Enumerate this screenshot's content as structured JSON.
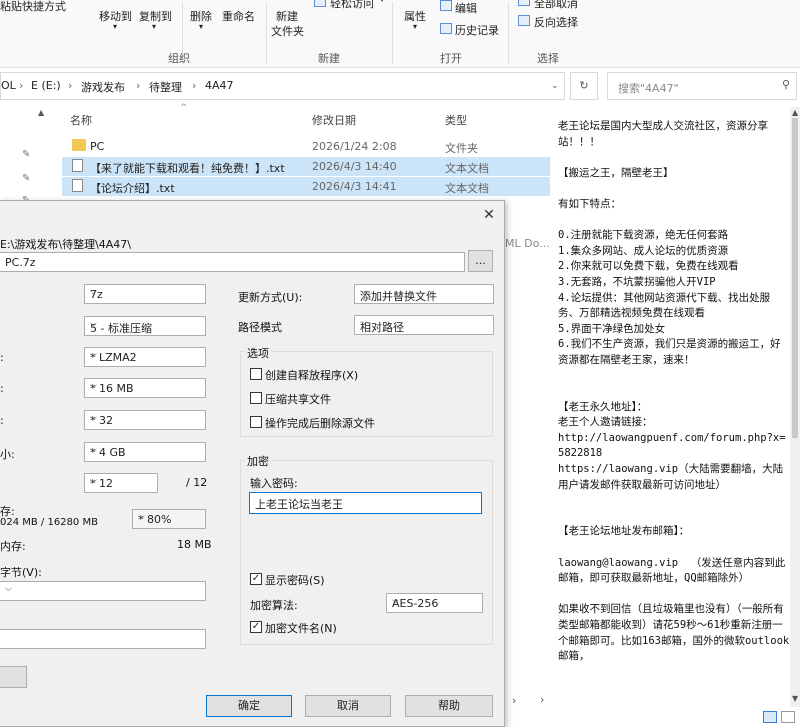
{
  "ribbon": {
    "paste_shortcut": "粘贴快捷方式",
    "move_to": "移动到",
    "copy_to": "复制到",
    "delete": "删除",
    "rename": "重命名",
    "new_folder_line1": "新建",
    "new_folder_line2": "文件夹",
    "easy_access": "轻松访问",
    "properties": "属性",
    "edit": "编辑",
    "history": "历史记录",
    "select_none": "全部取消",
    "invert_selection": "反向选择",
    "groups": {
      "organize": "组织",
      "new": "新建",
      "open": "打开",
      "select": "选择"
    }
  },
  "address": {
    "parts": [
      "OL",
      "E (E:)",
      "游戏发布",
      "待整理",
      "4A47"
    ],
    "search_placeholder": "搜索\"4A47\""
  },
  "columns": {
    "name": "名称",
    "date": "修改日期",
    "type": "类型"
  },
  "files": [
    {
      "name": "PC",
      "date": "2026/1/24 2:08",
      "type": "文件夹"
    },
    {
      "name": "【来了就能下载和观看！纯免费！】.txt",
      "date": "2026/4/3 14:40",
      "type": "文本文档"
    },
    {
      "name": "【论坛介绍】.txt",
      "date": "2026/4/3 14:41",
      "type": "文本文档"
    }
  ],
  "partial_type": "ML Do...",
  "preview_text": "老王论坛是国内大型成人交流社区，资源分享站！！！\n\n【搬运之王，隔壁老王】\n\n有如下特点：\n\n0.注册就能下载资源，绝无任何套路\n1.集众多网站、成人论坛的优质资源\n2.你来就可以免费下载，免费在线观看\n3.无套路，不坑蒙拐骗他人开VIP\n4.论坛提供：其他网站资源代下载、找出处服务、万部精选视频免费在线观看\n5.界面干净绿色加处女\n6.我们不生产资源，我们只是资源的搬运工，好资源都在隔壁老王家，速来！\n\n\n【老王永久地址】：\n老王个人邀请链接：\nhttp://laowangpuenf.com/forum.php?x=5822818\nhttps://laowang.vip（大陆需要翻墙，大陆用户请发邮件获取最新可访问地址）\n\n\n【老王论坛地址发布邮箱】：\n\nlaowang@laowang.vip  （发送任意内容到此邮箱，即可获取最新地址，QQ邮箱除外）\n\n如果收不到回信（且垃圾箱里也没有）（一般所有类型邮箱都能收到）请花59秒～61秒重新注册一个邮箱即可。比如163邮箱，国外的微软outlook邮箱，",
  "dialog": {
    "path": "E:\\游戏发布\\待整理\\4A47\\",
    "archive_name": "PC.7z",
    "browse": "...",
    "format": "7z",
    "level": "5 - 标准压缩",
    "method": "* LZMA2",
    "dict": "* 16 MB",
    "word": "* 32",
    "solid": "* 4 GB",
    "threads": "* 12",
    "threads_total": "/ 12",
    "mem_label": "存:",
    "mem_value": "024 MB / 16280 MB",
    "mem_pct": "* 80%",
    "decomp_label": "内存:",
    "decomp_value": "18 MB",
    "split_label": "字节(V):",
    "lbl_colon1": ":",
    "lbl_colon2": ":",
    "lbl_colon3": ":",
    "lbl_size": "小:",
    "update_mode_label": "更新方式(U):",
    "update_mode": "添加并替换文件",
    "path_mode_label": "路径模式",
    "path_mode": "相对路径",
    "options_title": "选项",
    "opt_sfx": "创建自释放程序(X)",
    "opt_shared": "压缩共享文件",
    "opt_delete": "操作完成后删除源文件",
    "encrypt_title": "加密",
    "password_label": "输入密码:",
    "password": "上老王论坛当老王",
    "show_password": "显示密码(S)",
    "enc_method_label": "加密算法:",
    "enc_method": "AES-256",
    "encrypt_names": "加密文件名(N)",
    "ok": "确定",
    "cancel": "取消",
    "help": "帮助",
    "close": "✕"
  }
}
